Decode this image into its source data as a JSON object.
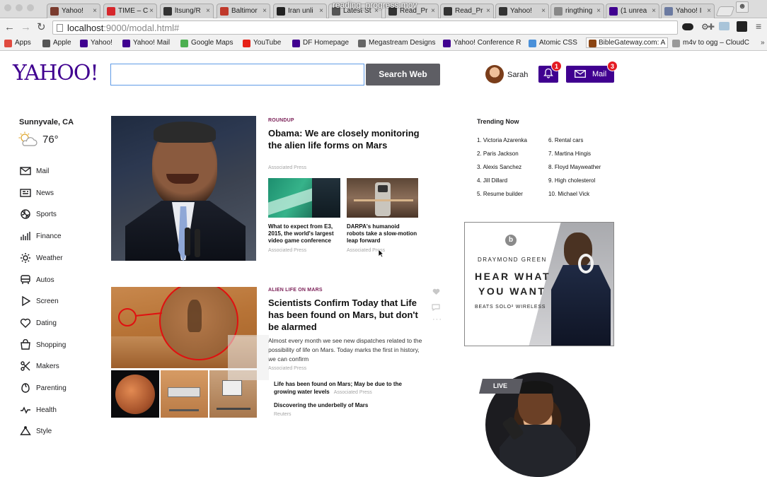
{
  "recording_overlay": "reading_progress.mov",
  "tabs": [
    {
      "label": "Yahoo!",
      "color": "#7a3b2e"
    },
    {
      "label": "TIME – C",
      "color": "#d6262b"
    },
    {
      "label": "ltsung/R",
      "color": "#333333"
    },
    {
      "label": "Baltimor",
      "color": "#c0392b"
    },
    {
      "label": "Iran unli",
      "color": "#222222"
    },
    {
      "label": "Latest St",
      "color": "#555555"
    },
    {
      "label": "Read_Pr",
      "color": "#333333"
    },
    {
      "label": "Read_Pr",
      "color": "#333333"
    },
    {
      "label": "Yahoo!",
      "color": "#333333"
    },
    {
      "label": "ringthing",
      "color": "#888888"
    },
    {
      "label": "(1 unrea",
      "color": "#400090"
    },
    {
      "label": "Yahoo! I",
      "color": "#6b7aa1"
    }
  ],
  "address_bar": {
    "url_host": "localhost",
    "url_rest": ":9000/modal.html#"
  },
  "bookmarks": [
    {
      "label": "Apps",
      "color": "#e04a3f"
    },
    {
      "label": "Apple",
      "color": "#555555"
    },
    {
      "label": "Yahoo!",
      "color": "#400090"
    },
    {
      "label": "Yahoo! Mail",
      "color": "#400090"
    },
    {
      "label": "Google Maps",
      "color": "#4caf50"
    },
    {
      "label": "YouTube",
      "color": "#e62117"
    },
    {
      "label": "DF Homepage",
      "color": "#400090"
    },
    {
      "label": "Megastream Designs",
      "color": "#666666"
    },
    {
      "label": "Yahoo! Conference R",
      "color": "#400090"
    },
    {
      "label": "Atomic CSS",
      "color": "#4a90d9"
    },
    {
      "label": "BibleGateway.com: A",
      "color": "#8b4513"
    },
    {
      "label": "m4v to ogg – CloudC",
      "color": "#999999"
    }
  ],
  "header": {
    "logo": "YAHOO!",
    "search_placeholder": "",
    "search_button": "Search Web",
    "user_name": "Sarah",
    "notifications_count": "1",
    "mail_label": "Mail",
    "mail_count": "3"
  },
  "weather": {
    "location": "Sunnyvale, CA",
    "temperature": "76°"
  },
  "nav_items": [
    {
      "label": "Mail",
      "icon": "mail-icon"
    },
    {
      "label": "News",
      "icon": "news-icon"
    },
    {
      "label": "Sports",
      "icon": "sports-icon"
    },
    {
      "label": "Finance",
      "icon": "finance-icon"
    },
    {
      "label": "Weather",
      "icon": "weather-icon"
    },
    {
      "label": "Autos",
      "icon": "autos-icon"
    },
    {
      "label": "Screen",
      "icon": "screen-icon"
    },
    {
      "label": "Dating",
      "icon": "dating-icon"
    },
    {
      "label": "Shopping",
      "icon": "shopping-icon"
    },
    {
      "label": "Makers",
      "icon": "makers-icon"
    },
    {
      "label": "Parenting",
      "icon": "parenting-icon"
    },
    {
      "label": "Health",
      "icon": "health-icon"
    },
    {
      "label": "Style",
      "icon": "style-icon"
    }
  ],
  "story1": {
    "category": "ROUNDUP",
    "headline": "Obama: We are closely monitoring the alien life forms on Mars",
    "source": "Associated Press",
    "sub1": {
      "text": "What to expect from E3, 2015, the world's largest video game conference",
      "source": "Associated Press"
    },
    "sub2": {
      "text": "DARPA's humanoid robots take a slow-motion leap forward",
      "source": "Associated Press"
    }
  },
  "story2": {
    "category": "ALIEN LIFE ON MARS",
    "headline": "Scientists Confirm Today that Life has been found on Mars, but don't be alarmed",
    "summary": "Almost every month we see new dispatches related to the possibility of life on Mars. Today marks the first in history, we can confirm",
    "source": "Associated Press",
    "bullets": [
      {
        "text": "Life has been found on Mars; May be due to the growing water levels",
        "source": "Associated Press"
      },
      {
        "text": "Discovering the underbelly of Mars",
        "source": "Reuters"
      }
    ]
  },
  "trending": {
    "title": "Trending Now",
    "items": [
      "1. Victoria Azarenka",
      "2. Paris Jackson",
      "3. Alexis Sanchez",
      "4. Jill Dillard",
      "5. Resume builder",
      "6. Rental cars",
      "7. Martina Hingis",
      "8. Floyd Mayweather",
      "9. High cholesterol",
      "10. Michael Vick"
    ]
  },
  "ad": {
    "name": "DRAYMOND GREEN",
    "line1": "HEAR WHAT",
    "line2": "YOU WANT",
    "product": "BEATS SOLO² WIRELESS"
  },
  "live_label": "LIVE",
  "colors": {
    "brand": "#400090",
    "badge": "#e41b23",
    "category": "#7a1e56"
  }
}
